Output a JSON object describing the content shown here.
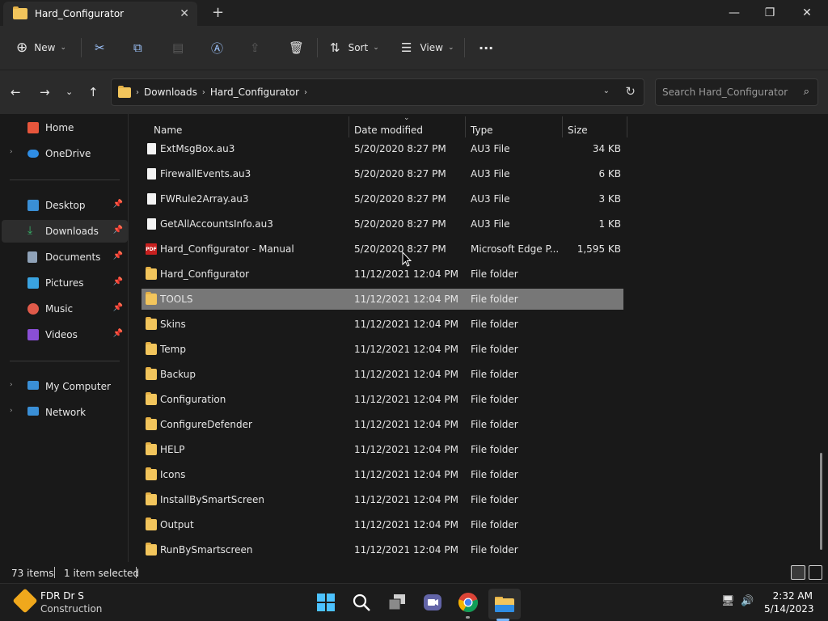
{
  "window": {
    "tab_title": "Hard_Configurator",
    "tab_close": "✕",
    "new_tab": "+",
    "minimize": "—",
    "maximize": "❐",
    "close": "✕"
  },
  "toolbar": {
    "new_label": "New",
    "sort_label": "Sort",
    "view_label": "View",
    "more_label": "···"
  },
  "address": {
    "crumbs": [
      "Downloads",
      "Hard_Configurator"
    ],
    "search_placeholder": "Search Hard_Configurator"
  },
  "sidebar": {
    "items": [
      {
        "label": "Home",
        "icon": "home-icon",
        "color": "#e7563c"
      },
      {
        "label": "OneDrive",
        "icon": "cloud-icon",
        "color": "#2f8de4"
      },
      {
        "label": "Desktop",
        "icon": "desktop-icon",
        "color": "#3a8fd6"
      },
      {
        "label": "Downloads",
        "icon": "download-icon",
        "color": "#38b46a"
      },
      {
        "label": "Documents",
        "icon": "document-icon",
        "color": "#8fa2b8"
      },
      {
        "label": "Pictures",
        "icon": "picture-icon",
        "color": "#3aa3e0"
      },
      {
        "label": "Music",
        "icon": "music-icon",
        "color": "#e05a4a"
      },
      {
        "label": "Videos",
        "icon": "video-icon",
        "color": "#8a4fd6"
      },
      {
        "label": "My Computer",
        "icon": "computer-icon",
        "color": "#3a8fd6"
      },
      {
        "label": "Network",
        "icon": "network-icon",
        "color": "#3a8fd6"
      }
    ]
  },
  "columns": {
    "name": "Name",
    "date": "Date modified",
    "type": "Type",
    "size": "Size"
  },
  "files": [
    {
      "name": "ExtMsgBox.au3",
      "date": "5/20/2020 8:27 PM",
      "type": "AU3 File",
      "size": "34 KB",
      "kind": "file"
    },
    {
      "name": "FirewallEvents.au3",
      "date": "5/20/2020 8:27 PM",
      "type": "AU3 File",
      "size": "6 KB",
      "kind": "file"
    },
    {
      "name": "FWRule2Array.au3",
      "date": "5/20/2020 8:27 PM",
      "type": "AU3 File",
      "size": "3 KB",
      "kind": "file"
    },
    {
      "name": "GetAllAccountsInfo.au3",
      "date": "5/20/2020 8:27 PM",
      "type": "AU3 File",
      "size": "1 KB",
      "kind": "file"
    },
    {
      "name": "Hard_Configurator - Manual",
      "date": "5/20/2020 8:27 PM",
      "type": "Microsoft Edge P...",
      "size": "1,595 KB",
      "kind": "pdf"
    },
    {
      "name": "Hard_Configurator",
      "date": "11/12/2021 12:04 PM",
      "type": "File folder",
      "size": "",
      "kind": "folder"
    },
    {
      "name": "TOOLS",
      "date": "11/12/2021 12:04 PM",
      "type": "File folder",
      "size": "",
      "kind": "folder"
    },
    {
      "name": "Skins",
      "date": "11/12/2021 12:04 PM",
      "type": "File folder",
      "size": "",
      "kind": "folder"
    },
    {
      "name": "Temp",
      "date": "11/12/2021 12:04 PM",
      "type": "File folder",
      "size": "",
      "kind": "folder"
    },
    {
      "name": "Backup",
      "date": "11/12/2021 12:04 PM",
      "type": "File folder",
      "size": "",
      "kind": "folder"
    },
    {
      "name": "Configuration",
      "date": "11/12/2021 12:04 PM",
      "type": "File folder",
      "size": "",
      "kind": "folder"
    },
    {
      "name": "ConfigureDefender",
      "date": "11/12/2021 12:04 PM",
      "type": "File folder",
      "size": "",
      "kind": "folder"
    },
    {
      "name": "HELP",
      "date": "11/12/2021 12:04 PM",
      "type": "File folder",
      "size": "",
      "kind": "folder"
    },
    {
      "name": "Icons",
      "date": "11/12/2021 12:04 PM",
      "type": "File folder",
      "size": "",
      "kind": "folder"
    },
    {
      "name": "InstallBySmartScreen",
      "date": "11/12/2021 12:04 PM",
      "type": "File folder",
      "size": "",
      "kind": "folder"
    },
    {
      "name": "Output",
      "date": "11/12/2021 12:04 PM",
      "type": "File folder",
      "size": "",
      "kind": "folder"
    },
    {
      "name": "RunBySmartscreen",
      "date": "11/12/2021 12:04 PM",
      "type": "File folder",
      "size": "",
      "kind": "folder"
    }
  ],
  "selected_file": "TOOLS",
  "status": {
    "count": "73 items",
    "selection": "1 item selected"
  },
  "taskbar": {
    "weather_title": "FDR Dr S",
    "weather_sub": "Construction",
    "time": "2:32 AM",
    "date": "5/14/2023"
  }
}
